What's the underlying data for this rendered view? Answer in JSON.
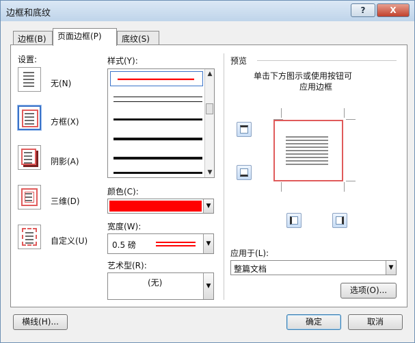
{
  "window": {
    "title": "边框和底纹",
    "help_label": "?",
    "close_label": "X"
  },
  "tabs": [
    {
      "label": "边框(B)"
    },
    {
      "label": "页面边框(P)"
    },
    {
      "label": "底纹(S)"
    }
  ],
  "settings": {
    "label": "设置:",
    "items": [
      {
        "label": "无(N)"
      },
      {
        "label": "方框(X)"
      },
      {
        "label": "阴影(A)"
      },
      {
        "label": "三维(D)"
      },
      {
        "label": "自定义(U)"
      }
    ]
  },
  "style_list": {
    "label": "样式(Y):",
    "up_arrow": "▲",
    "down_arrow": "▼"
  },
  "color": {
    "label": "颜色(C):",
    "value": "#ff0000"
  },
  "width": {
    "label": "宽度(W):",
    "value": "0.5 磅"
  },
  "art": {
    "label": "艺术型(R):",
    "value": "(无)"
  },
  "preview": {
    "label": "预览",
    "hint_line1": "单击下方图示或使用按钮可",
    "hint_line2": "应用边框"
  },
  "apply_to": {
    "label": "应用于(L):",
    "value": "整篇文档"
  },
  "buttons": {
    "options": "选项(O)...",
    "horizontal_line": "横线(H)...",
    "ok": "确定",
    "cancel": "取消"
  },
  "icons": {
    "dropdown": "▼"
  },
  "colors": {
    "border_red": "#ff0000",
    "accent_blue": "#3a73c9"
  }
}
